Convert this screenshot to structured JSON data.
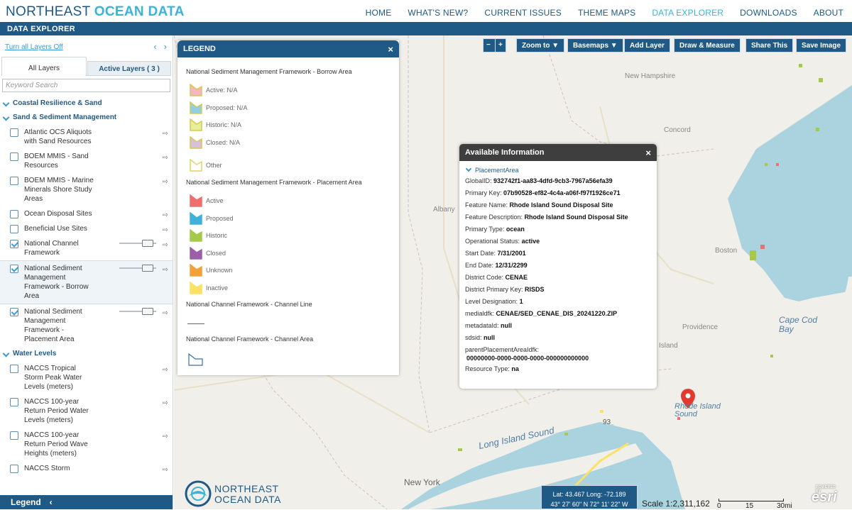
{
  "header": {
    "brand_plain": "NORTHEAST ",
    "brand_bold": "OCEAN DATA",
    "nav": [
      "HOME",
      "WHAT'S NEW?",
      "CURRENT ISSUES",
      "THEME MAPS",
      "DATA EXPLORER",
      "DOWNLOADS",
      "ABOUT"
    ],
    "active_nav": "DATA EXPLORER"
  },
  "subbar": {
    "title": "DATA EXPLORER"
  },
  "sidebar": {
    "turn_off": "Turn all Layers Off",
    "tab_all": "All Layers",
    "tab_active": "Active Layers ( 3 )",
    "search_placeholder": "Keyword Search",
    "sections": [
      {
        "title": "Coastal Resilience & Sand",
        "layers": []
      },
      {
        "title": "Sand & Sediment Management",
        "layers": [
          {
            "label": "Atlantic OCS Aliquots with Sand Resources",
            "checked": false
          },
          {
            "label": "BOEM MMIS - Sand Resources",
            "checked": false
          },
          {
            "label": "BOEM MMIS - Marine Minerals Shore Study Areas",
            "checked": false
          },
          {
            "label": "Ocean Disposal Sites",
            "checked": false
          },
          {
            "label": "Beneficial Use Sites",
            "checked": false
          },
          {
            "label": "National Channel Framework",
            "checked": true
          },
          {
            "label": "National Sediment Management Framework - Borrow Area",
            "checked": true
          },
          {
            "label": "National Sediment Management Framework - Placement Area",
            "checked": true
          }
        ]
      },
      {
        "title": "Water Levels",
        "layers": [
          {
            "label": "NACCS Tropical Storm Peak Water Levels (meters)",
            "checked": false
          },
          {
            "label": "NACCS 100-year Return Period Water Levels (meters)",
            "checked": false
          },
          {
            "label": "NACCS 100-year Return Period Wave Heights (meters)",
            "checked": false
          },
          {
            "label": "NACCS Storm",
            "checked": false
          }
        ]
      }
    ],
    "legend_label": "Legend"
  },
  "toolbar": {
    "zoom_out": "−",
    "zoom_in": "+",
    "zoom_to": "Zoom to ▼",
    "basemaps": "Basemaps ▼",
    "add_layer": "Add Layer",
    "draw": "Draw & Measure",
    "share": "Share This",
    "save": "Save Image"
  },
  "legend": {
    "title": "LEGEND",
    "groups": [
      {
        "title": "National Sediment Management Framework - Borrow Area",
        "items": [
          {
            "label": "Active: N/A",
            "color": "#f4b6c2",
            "edge": "#d9c94e"
          },
          {
            "label": "Proposed: N/A",
            "color": "#8fd0e6",
            "edge": "#d9c94e"
          },
          {
            "label": "Historic: N/A",
            "color": "#e6ee9a",
            "edge": "#d9c94e"
          },
          {
            "label": "Closed: N/A",
            "color": "#d7c0dc",
            "edge": "#d9c94e"
          },
          {
            "label": "Other",
            "color": "#ffffff",
            "edge": "#e2d466"
          }
        ]
      },
      {
        "title": "National Sediment Management Framework - Placement Area",
        "items": [
          {
            "label": "Active",
            "color": "#ef6f6f",
            "edge": "#ef6f6f"
          },
          {
            "label": "Proposed",
            "color": "#3fb2d9",
            "edge": "#3fb2d9"
          },
          {
            "label": "Historic",
            "color": "#a6c94a",
            "edge": "#a6c94a"
          },
          {
            "label": "Closed",
            "color": "#9a5fa6",
            "edge": "#9a5fa6"
          },
          {
            "label": "Unknown",
            "color": "#f4a13c",
            "edge": "#f4a13c"
          },
          {
            "label": "Inactive",
            "color": "#fbe166",
            "edge": "#fbe166"
          }
        ]
      },
      {
        "title": "National Channel Framework - Channel Line",
        "items": []
      },
      {
        "title": "National Channel Framework - Channel Area",
        "items": []
      }
    ]
  },
  "info": {
    "title": "Available Information",
    "subtitle": "PlacementArea",
    "rows": [
      {
        "k": "GlobalID:",
        "v": "932742f1-aa83-4dfd-9cb3-7967a56efa39"
      },
      {
        "k": "Primary Key:",
        "v": "07b90528-ef82-4c4a-a06f-f97f1926ce71"
      },
      {
        "k": "Feature Name:",
        "v": "Rhode Island Sound Disposal Site"
      },
      {
        "k": "Feature Description:",
        "v": "Rhode Island Sound Disposal Site"
      },
      {
        "k": "Primary Type:",
        "v": "ocean"
      },
      {
        "k": "Operational Status:",
        "v": "active"
      },
      {
        "k": "Start Date:",
        "v": "7/31/2001"
      },
      {
        "k": "End Date:",
        "v": "12/31/2299"
      },
      {
        "k": "District Code:",
        "v": "CENAE"
      },
      {
        "k": "District Primary Key:",
        "v": "RISDS"
      },
      {
        "k": "Level Designation:",
        "v": "1"
      },
      {
        "k": "medialdfk:",
        "v": "CENAE/SED_CENAE_DIS_20241220.ZIP"
      },
      {
        "k": "metadataId:",
        "v": "null"
      },
      {
        "k": "sdsid:",
        "v": "null"
      },
      {
        "k": "parentPlacementAreaIdfk:",
        "v": ""
      },
      {
        "k": "",
        "v": "00000000-0000-0000-0000-000000000000"
      },
      {
        "k": "Resource Type:",
        "v": "na"
      }
    ]
  },
  "map_labels": {
    "new_hampshire": "New Hampshire",
    "concord": "Concord",
    "albany": "Albany",
    "boston": "Boston",
    "providence": "Providence",
    "island": "Island",
    "cape_cod_bay": "Cape Cod Bay",
    "rhode_island_sound": "Rhode Island Sound",
    "long_island_sound": "Long Island Sound",
    "new_york": "New York",
    "route": "93"
  },
  "coords": {
    "latlong": "Lat: 43.467  Long: -72.189",
    "dms": "43° 27' 60\" N 72° 11' 22\" W"
  },
  "scale": {
    "text": "Scale 1:2,311,162",
    "ticks": [
      "0",
      "15",
      "30mi"
    ]
  },
  "esri": {
    "powered": "POWERED BY",
    "name": "esri"
  },
  "logo": {
    "line1": "NORTHEAST",
    "line2": "OCEAN DATA"
  }
}
